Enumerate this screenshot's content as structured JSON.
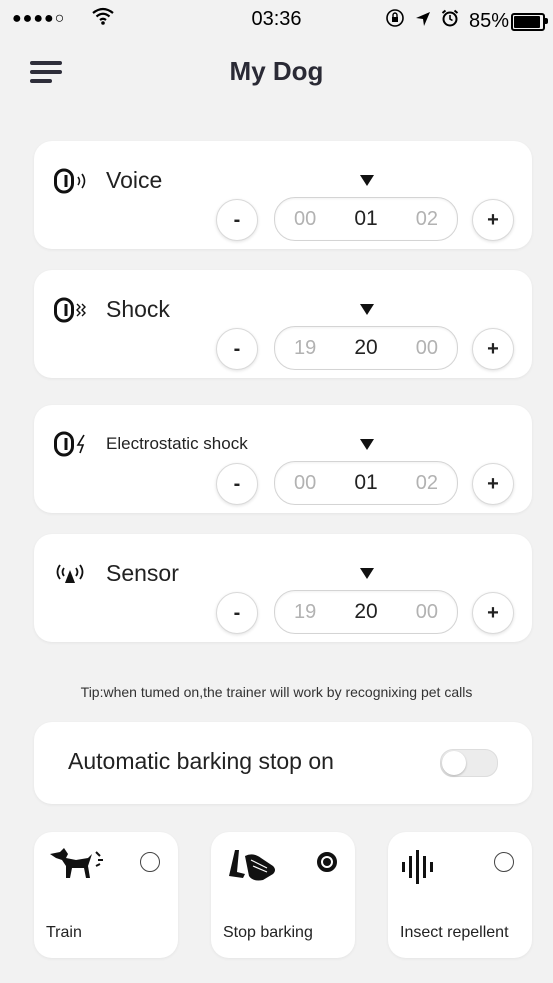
{
  "status_bar": {
    "signal": "●●●●○",
    "time": "03:36",
    "battery_text": "85%",
    "battery_level": 0.85
  },
  "header": {
    "title": "My Dog"
  },
  "modes": [
    {
      "label": "Voice",
      "icon": "voice-icon",
      "picker": [
        "00",
        "01",
        "02"
      ]
    },
    {
      "label": "Shock",
      "icon": "shock-icon",
      "picker": [
        "19",
        "20",
        "00"
      ]
    },
    {
      "label": "Electrostatic shock",
      "icon": "electrostatic-shock-icon",
      "picker": [
        "00",
        "01",
        "02"
      ]
    },
    {
      "label": "Sensor",
      "icon": "sensor-icon",
      "picker": [
        "19",
        "20",
        "00"
      ]
    }
  ],
  "stepper": {
    "minus": "-",
    "plus": "+"
  },
  "tip": "Tip:when tumed on,the trainer will work by recognixing pet calls",
  "auto_bark": {
    "label": "Automatic barking stop on",
    "enabled": false
  },
  "functions": [
    {
      "label": "Train",
      "icon": "dog-icon",
      "selected": false
    },
    {
      "label": "Stop barking",
      "icon": "hand-icon",
      "selected": true
    },
    {
      "label": "Insect repellent",
      "icon": "sound-wave-icon",
      "selected": false
    }
  ],
  "colors": {
    "background": "#f2f2f2",
    "card": "#ffffff",
    "title": "#2a2a35",
    "accent": "#111111"
  }
}
